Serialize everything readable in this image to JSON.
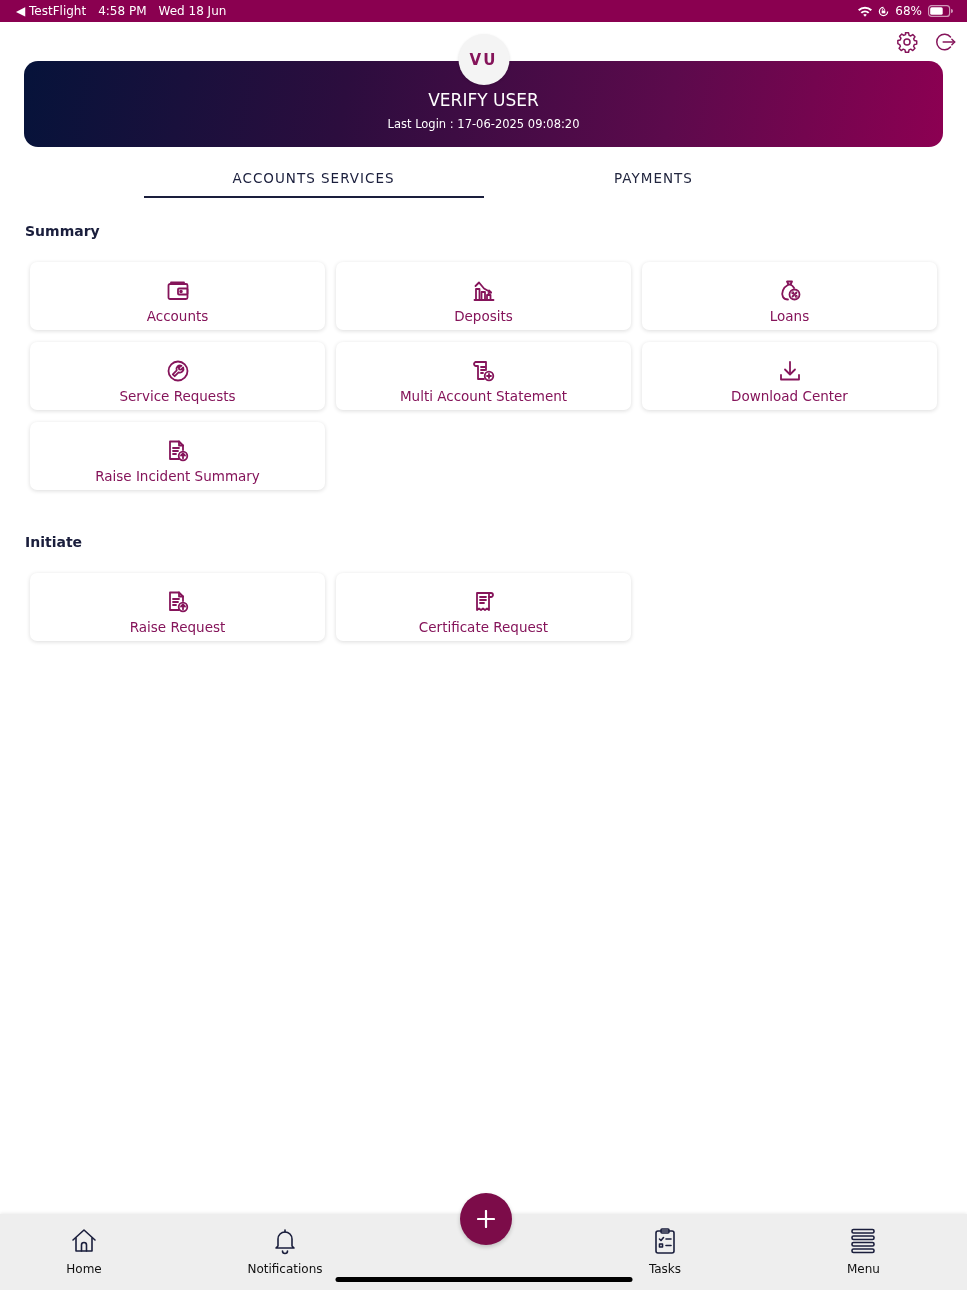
{
  "status_bar": {
    "back_link": "◀ TestFlight",
    "time": "4:58 PM",
    "date": "Wed 18 Jun",
    "battery": "68%"
  },
  "profile": {
    "initials": "VU",
    "name": "VERIFY USER",
    "last_login": "Last Login : 17-06-2025 09:08:20"
  },
  "tabs": [
    {
      "label": "ACCOUNTS SERVICES",
      "selected": true
    },
    {
      "label": "PAYMENTS",
      "selected": false
    }
  ],
  "sections": [
    {
      "title": "Summary",
      "tiles": [
        {
          "label": "Accounts",
          "kind": "wallet"
        },
        {
          "label": "Deposits",
          "kind": "deposit"
        },
        {
          "label": "Loans",
          "kind": "loan"
        },
        {
          "label": "Service Requests",
          "kind": "service"
        },
        {
          "label": "Multi Account Statement",
          "kind": "statement"
        },
        {
          "label": "Download Center",
          "kind": "download"
        },
        {
          "label": "Raise Incident Summary",
          "kind": "upload"
        }
      ]
    },
    {
      "title": "Initiate",
      "tiles": [
        {
          "label": "Raise Request",
          "kind": "upload"
        },
        {
          "label": "Certificate Request",
          "kind": "certificate"
        }
      ]
    }
  ],
  "bottom_nav": {
    "items": [
      {
        "label": "Home",
        "kind": "home"
      },
      {
        "label": "Notifications",
        "kind": "bell"
      },
      {
        "label": "Tasks",
        "kind": "tasks"
      },
      {
        "label": "Menu",
        "kind": "menu"
      }
    ]
  }
}
